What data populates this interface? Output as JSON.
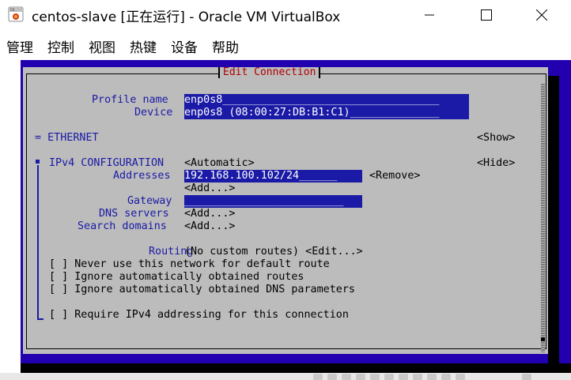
{
  "window": {
    "title": "centos-slave [正在运行] - Oracle VM VirtualBox",
    "minimize_glyph": "—",
    "maximize_glyph": "☐",
    "close_glyph": "✕",
    "icon": "virtualbox-app-icon"
  },
  "menu": [
    "管理",
    "控制",
    "视图",
    "热键",
    "设备",
    "帮助"
  ],
  "dialog": {
    "title": "Edit Connection",
    "profile_name_label": "Profile name",
    "profile_name_value": "enp0s8__________________________________",
    "device_label": "Device",
    "device_value": "enp0s8 (08:00:27:DB:B1:C1)______________",
    "ethernet_section": "= ETHERNET",
    "ethernet_toggle": "<Show>",
    "ipv4_marker": "■",
    "ipv4_label": "IPv4 CONFIGURATION",
    "ipv4_mode": "<Automatic>",
    "ipv4_toggle": "<Hide>",
    "addresses_label": "Addresses",
    "address_value": "192.168.100.102/24______",
    "remove_button": "<Remove>",
    "add_address_button": "<Add...>",
    "gateway_label": "Gateway",
    "gateway_value": "_________________________",
    "dns_label": "DNS servers",
    "dns_add_button": "<Add...>",
    "search_label": "Search domains",
    "search_add_button": "<Add...>",
    "routing_label": "Routing",
    "routing_value": "(No custom routes) <Edit...>",
    "checkboxes": [
      "[ ] Never use this network for default route",
      "[ ] Ignore automatically obtained routes",
      "[ ] Ignore automatically obtained DNS parameters"
    ],
    "require_checkbox": "[ ] Require IPv4 addressing for this connection"
  },
  "colors": {
    "vm_background": "#2200b0",
    "dialog_background": "#bcbcbc",
    "field_background": "#1a1aa6",
    "title_red": "#b00000"
  }
}
